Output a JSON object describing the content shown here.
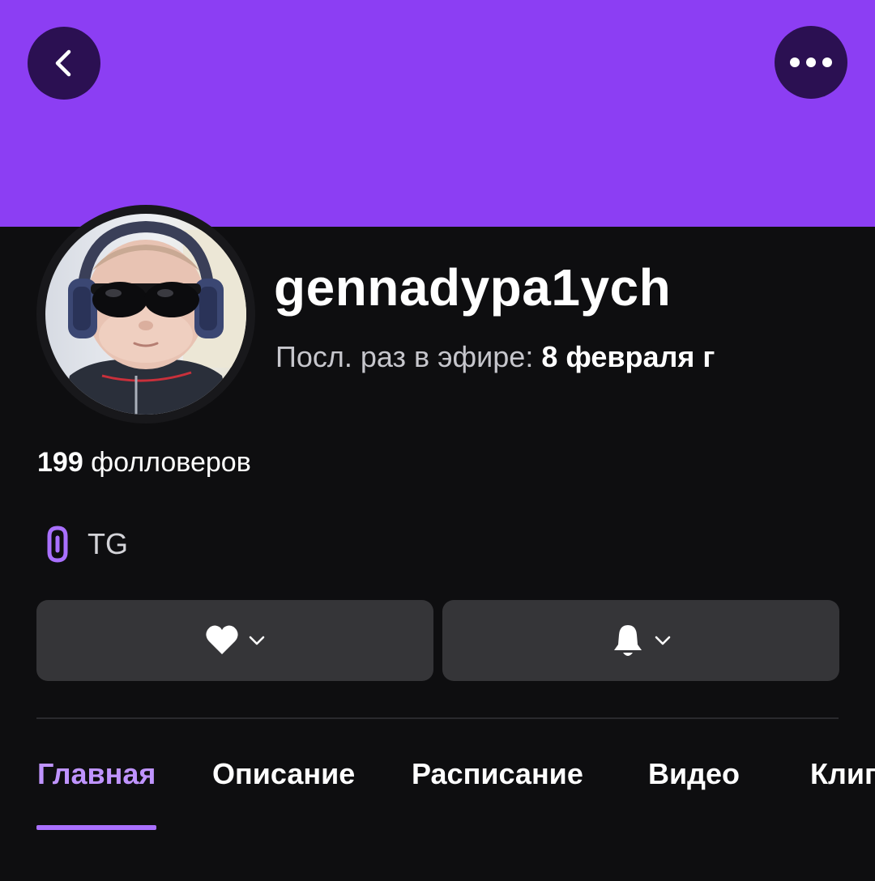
{
  "header": {
    "back_icon": "chevron-left-icon",
    "more_icon": "more-horizontal-icon",
    "banner_color": "#8c3ef3"
  },
  "profile": {
    "username": "gennadypa1ych",
    "last_live_prefix": "Посл. раз в эфире: ",
    "last_live_date": "8 февраля  г",
    "followers_count": "199",
    "followers_label": " фолловеров"
  },
  "links": [
    {
      "icon": "link-icon",
      "label": "TG"
    }
  ],
  "actions": {
    "follow_icon": "heart-icon",
    "notify_icon": "bell-icon"
  },
  "tabs": [
    {
      "label": "Главная",
      "active": true
    },
    {
      "label": "Описание",
      "active": false
    },
    {
      "label": "Расписание",
      "active": false
    },
    {
      "label": "Видео",
      "active": false
    },
    {
      "label": "Клипы",
      "active": false
    }
  ],
  "colors": {
    "accent": "#a970ff",
    "active_tab": "#bf94ff",
    "background": "#0e0e10",
    "button": "#353538"
  }
}
